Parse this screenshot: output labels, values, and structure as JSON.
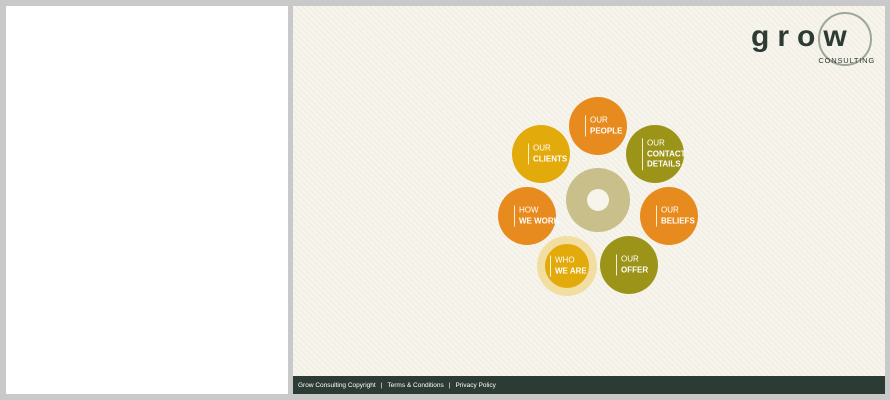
{
  "logo": {
    "word": "grow",
    "sub": "CONSULTING"
  },
  "nav": {
    "people": {
      "l1": "OUR",
      "l2": "PEOPLE",
      "color": "#e88b1e"
    },
    "clients": {
      "l1": "OUR",
      "l2": "CLIENTS",
      "color": "#e2aa0a"
    },
    "contact": {
      "l1": "OUR",
      "l2": "CONTACT",
      "l3": "DETAILS",
      "color": "#9b9418"
    },
    "how": {
      "l1": "HOW",
      "l2": "WE WORK",
      "color": "#e88b1e"
    },
    "beliefs": {
      "l1": "OUR",
      "l2": "BELIEFS",
      "color": "#e88b1e"
    },
    "who": {
      "l1": "WHO",
      "l2": "WE ARE",
      "color": "#e2aa0a"
    },
    "offer": {
      "l1": "OUR",
      "l2": "OFFER",
      "color": "#9b9418"
    }
  },
  "footer": {
    "copyright": "Grow Consulting Copyright",
    "sep": "|",
    "terms": "Terms & Conditions",
    "privacy": "Privacy Policy"
  }
}
